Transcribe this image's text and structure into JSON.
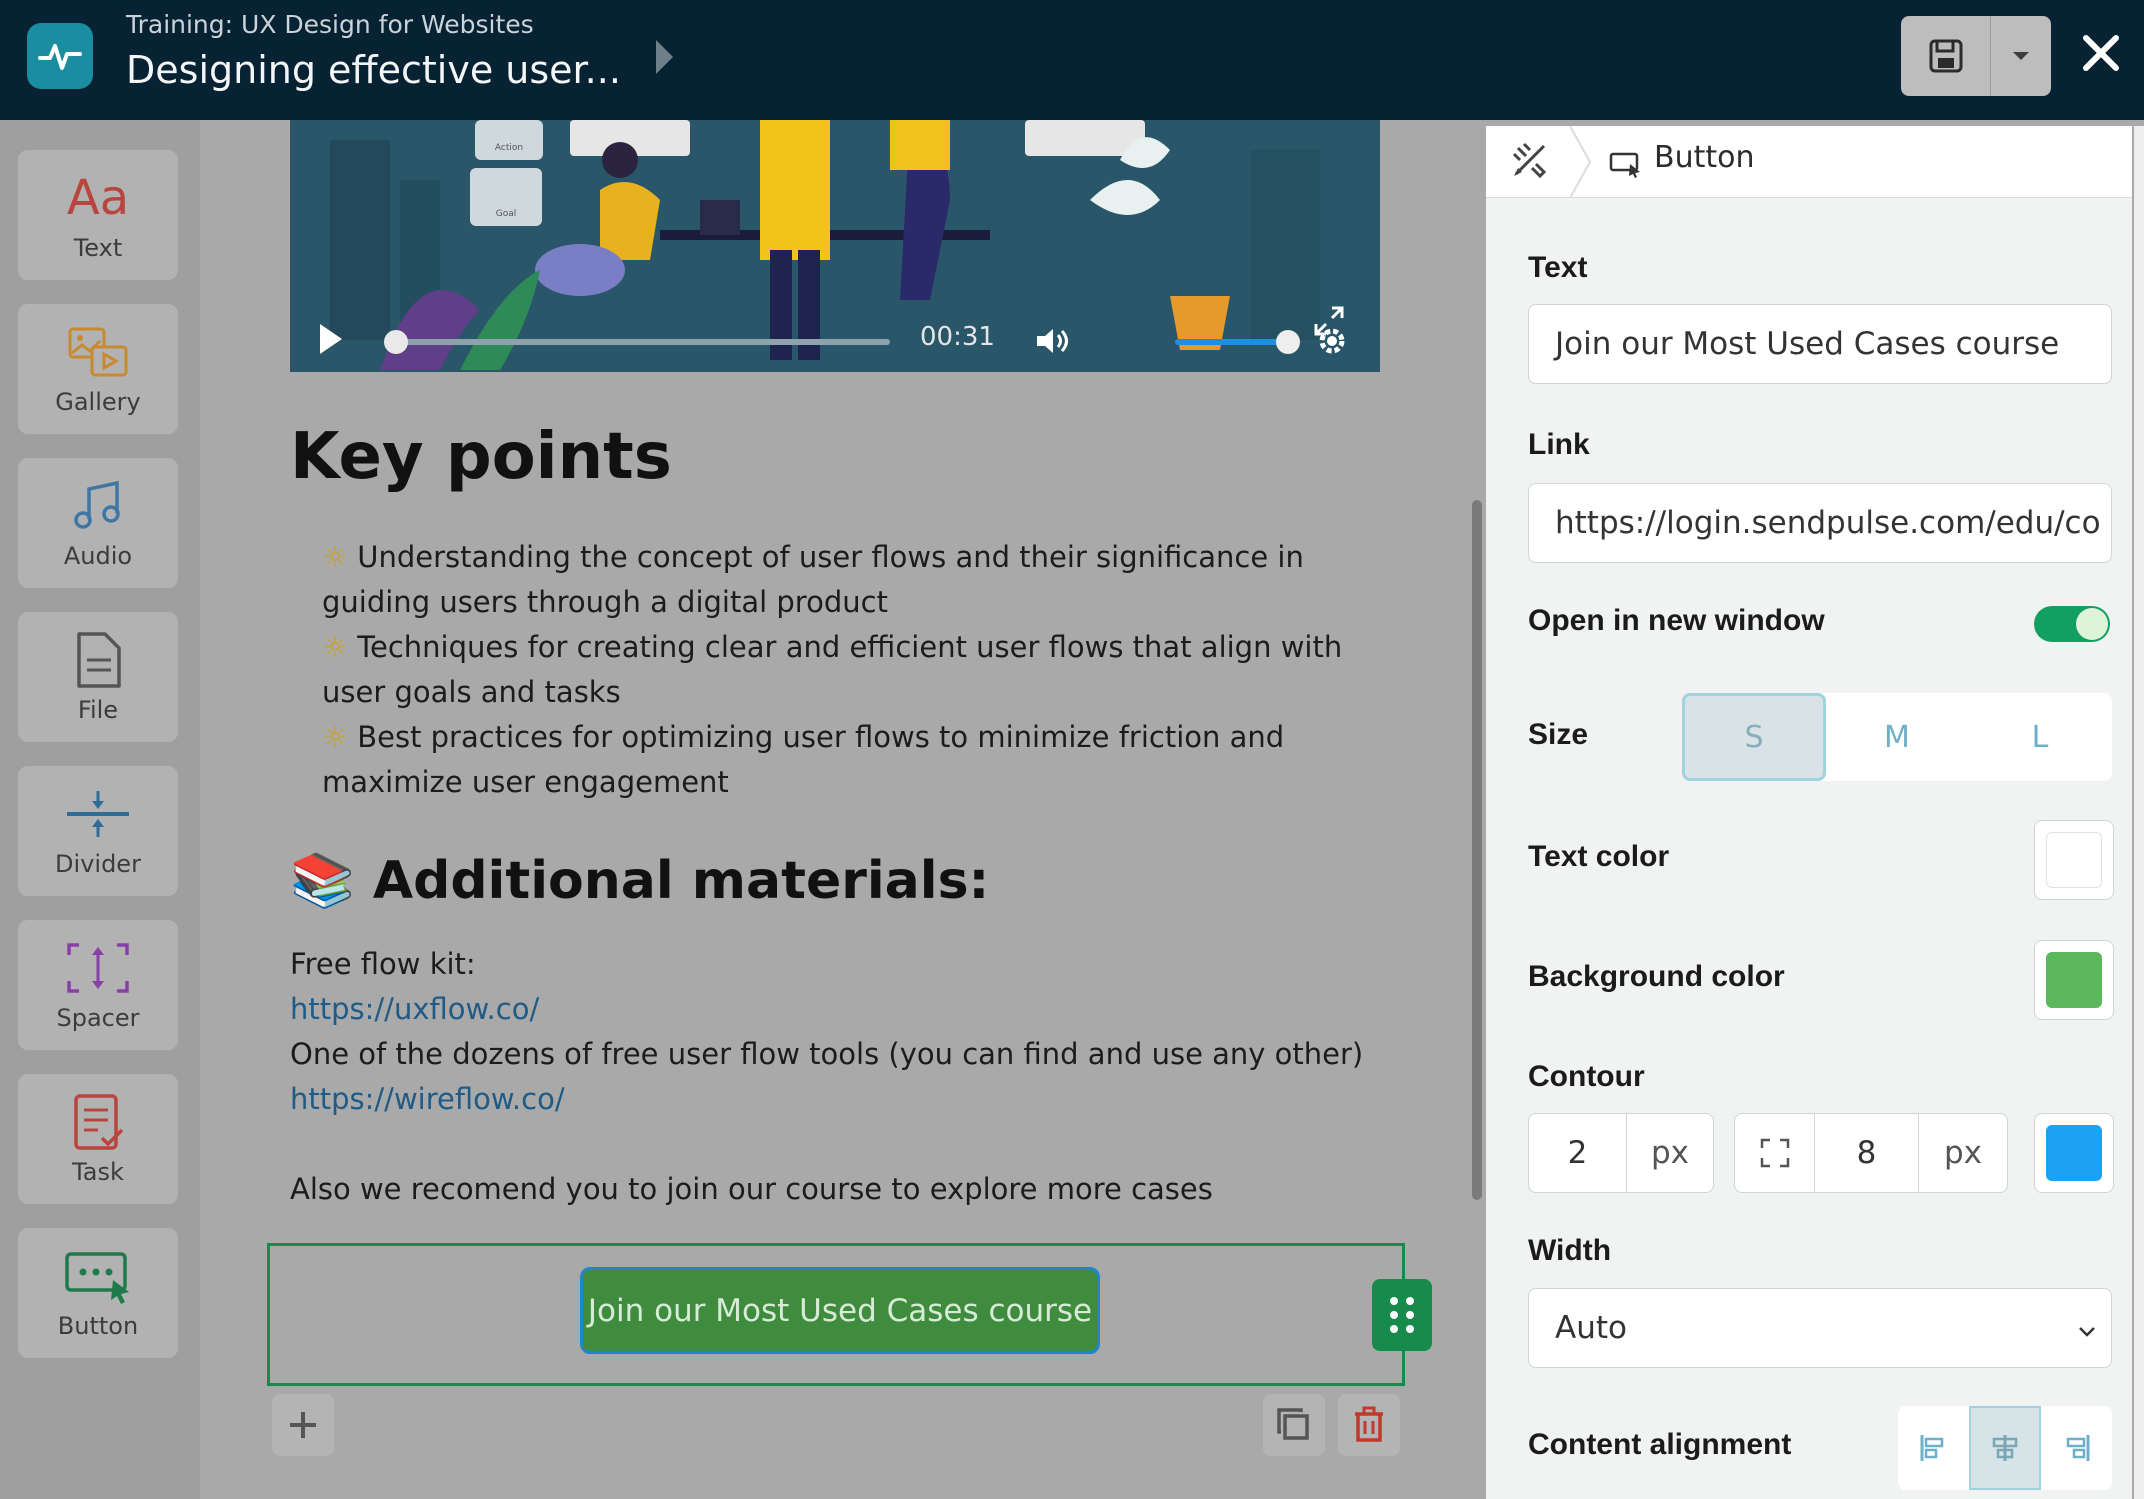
{
  "header": {
    "breadcrumb": "Training: UX Design for Websites",
    "title": "Designing effective user..."
  },
  "rail": {
    "items": [
      {
        "label": "Text",
        "icon": "text-icon"
      },
      {
        "label": "Gallery",
        "icon": "gallery-icon"
      },
      {
        "label": "Audio",
        "icon": "audio-icon"
      },
      {
        "label": "File",
        "icon": "file-icon"
      },
      {
        "label": "Divider",
        "icon": "divider-icon"
      },
      {
        "label": "Spacer",
        "icon": "spacer-icon"
      },
      {
        "label": "Task",
        "icon": "task-icon"
      },
      {
        "label": "Button",
        "icon": "button-icon"
      }
    ]
  },
  "video": {
    "time": "00:31",
    "progress": 0.03,
    "volume": 1.0,
    "sign_action": "Action",
    "sign_goal": "Goal"
  },
  "content": {
    "heading": "Key points",
    "bullets": [
      "Understanding the concept of user flows and their significance in guiding users through a digital product",
      "Techniques for creating clear and efficient user flows that align with user goals and tasks",
      "Best practices for optimizing user flows to minimize friction and maximize user engagement"
    ],
    "bullet_glyph": "☼",
    "materials_heading": "📚 Additional materials:",
    "kit_label": "Free flow kit:",
    "link1": "https://uxflow.co/",
    "tools_text": "One of the dozens of free user flow tools (you can find and use any other)",
    "link2": "https://wireflow.co/",
    "recommend": "Also we recomend you to join our course to explore more cases",
    "cta_label": "Join our Most Used Cases course"
  },
  "panel": {
    "title": "Button",
    "text_label": "Text",
    "text_value": "Join our Most Used Cases course",
    "link_label": "Link",
    "link_value": "https://login.sendpulse.com/edu/co",
    "new_window_label": "Open in new window",
    "new_window_on": true,
    "size_label": "Size",
    "sizes": [
      "S",
      "M",
      "L"
    ],
    "size_selected": "S",
    "text_color_label": "Text color",
    "text_color": "#ffffff",
    "bg_color_label": "Background color",
    "bg_color": "#5cb85c",
    "contour_label": "Contour",
    "contour_width": "2",
    "contour_unit": "px",
    "contour_radius": "8",
    "radius_unit": "px",
    "contour_color": "#1da1f2",
    "width_label": "Width",
    "width_value": "Auto",
    "alignment_label": "Content alignment",
    "alignment_selected": "center"
  }
}
